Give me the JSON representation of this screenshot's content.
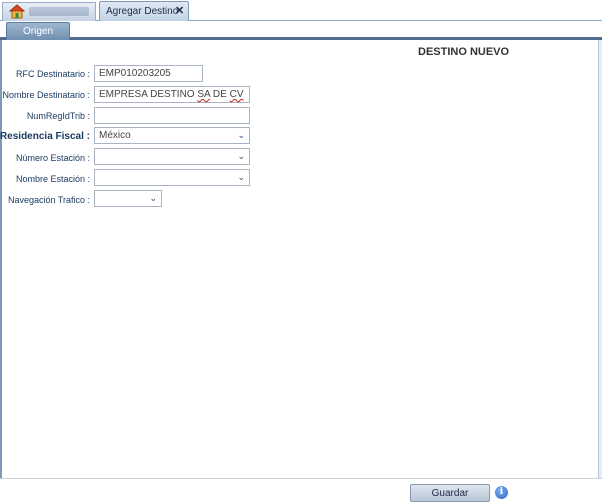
{
  "tabs": {
    "home": {
      "icon": "home-icon"
    },
    "active": {
      "label": "Agregar Destino",
      "close_icon": "close-icon",
      "close_glyph": "✕"
    }
  },
  "subtabs": {
    "origen": "Origen"
  },
  "form": {
    "title": "DESTINO NUEVO",
    "rfc": {
      "label": "RFC Destinatario :",
      "value": "EMP010203205"
    },
    "nombre": {
      "label": "Nombre Destinatario :",
      "value_prefix": "EMPRESA DESTINO ",
      "value_sa": "SA",
      "value_de": " DE ",
      "value_cv": "CV"
    },
    "numregidtrib": {
      "label": "NumRegIdTrib :",
      "value": ""
    },
    "residencia": {
      "label": "Residencia Fiscal :",
      "value": "México"
    },
    "numero_estacion": {
      "label": "Número Estación :",
      "value": ""
    },
    "nombre_estacion": {
      "label": "Nombre Estación :",
      "value": ""
    },
    "navegacion": {
      "label": "Navegación Trafico :",
      "value": ""
    },
    "select_arrow": "⌄"
  },
  "footer": {
    "save_label": "Guardar",
    "info_icon": "info-icon",
    "info_glyph": "i"
  },
  "colors": {
    "label_text": "#17375e",
    "tab_border": "#4f6c8e",
    "accent": "#2a64c4"
  }
}
